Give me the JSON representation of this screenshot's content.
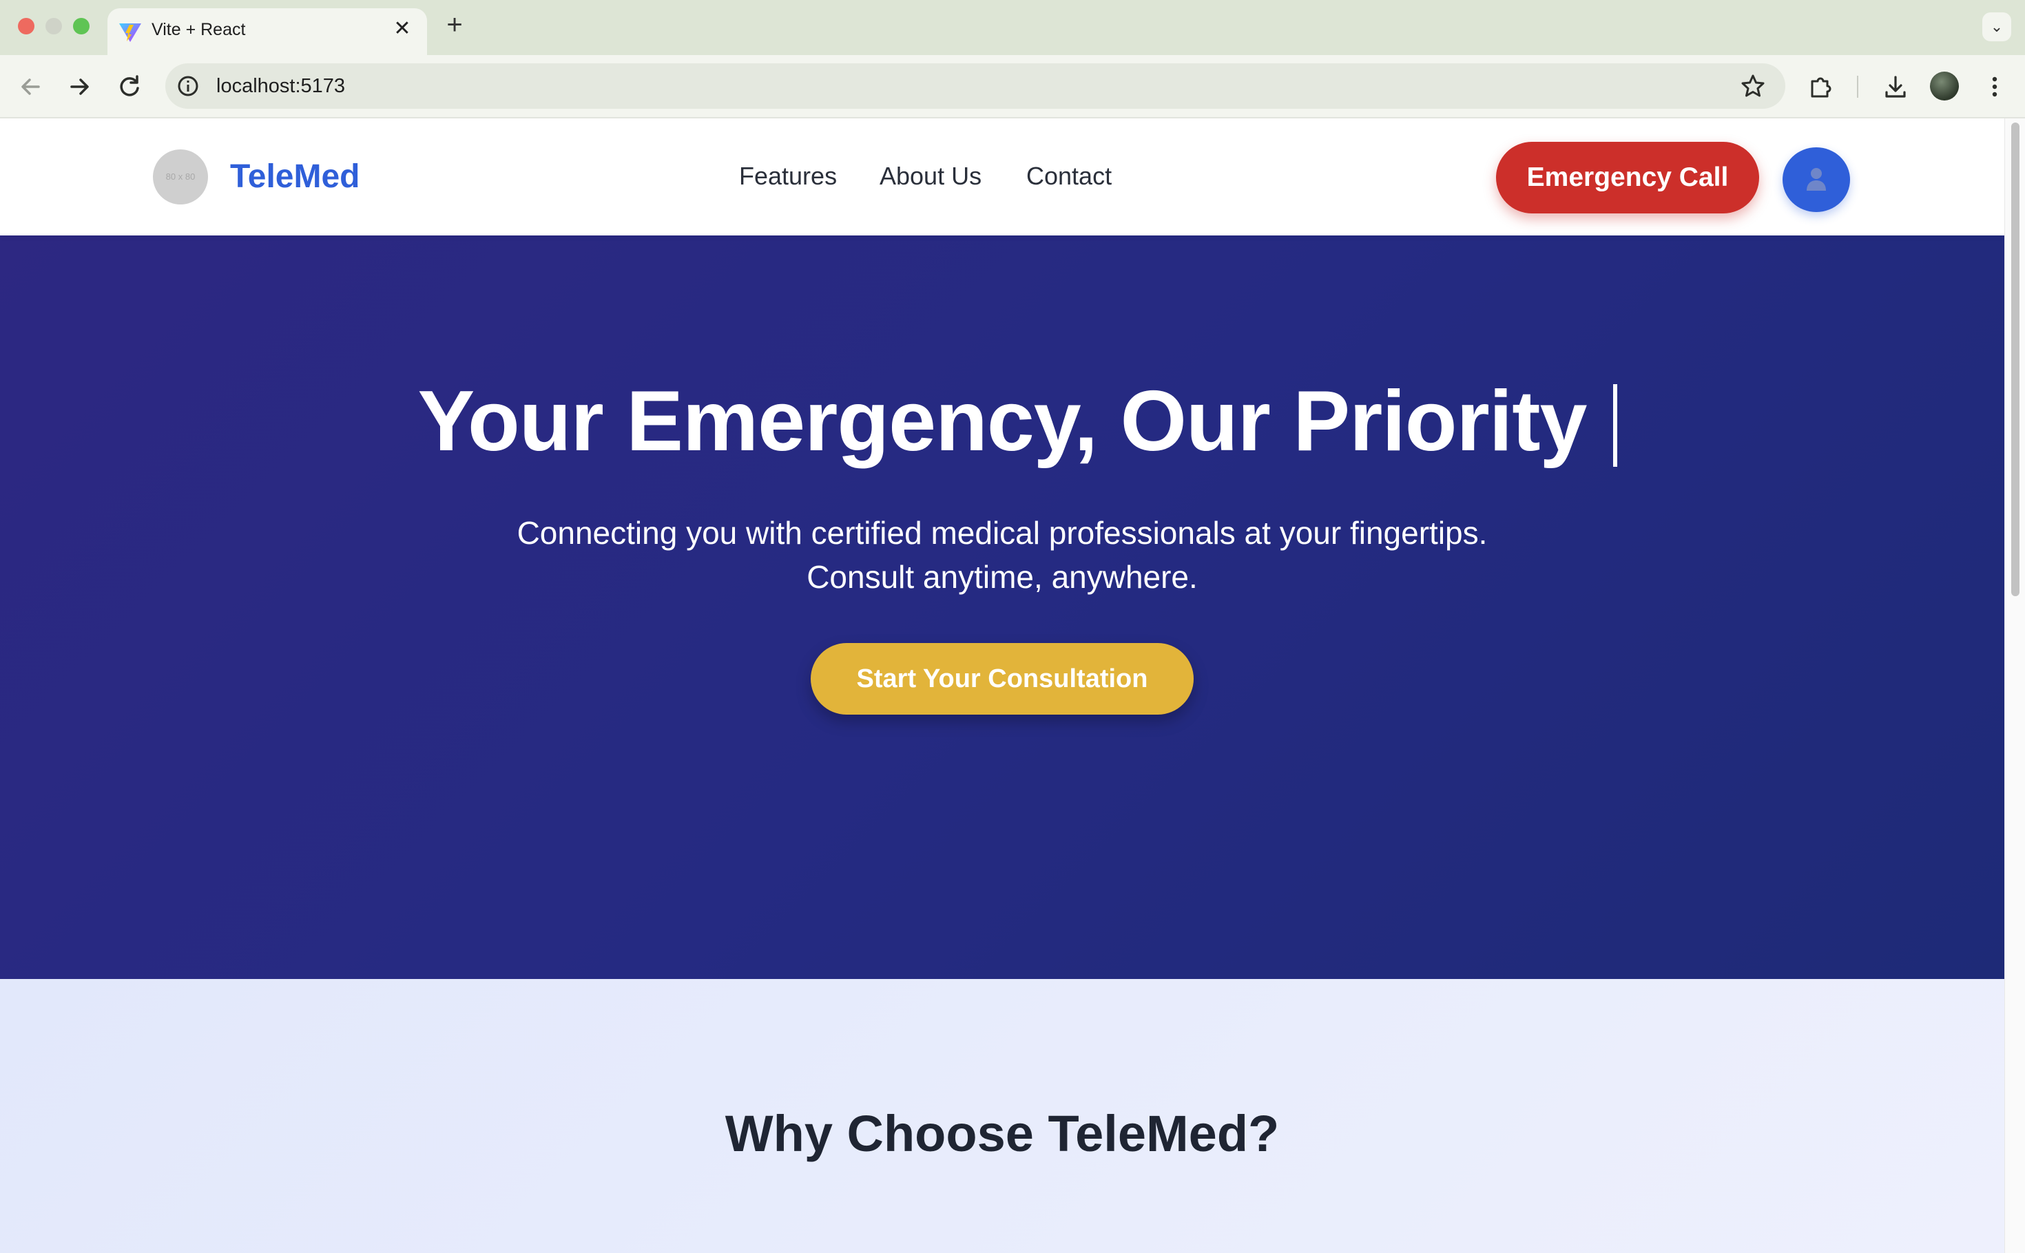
{
  "browser": {
    "tab_title": "Vite + React",
    "tab_close": "✕",
    "new_tab": "+",
    "address": "localhost:5173",
    "tab_search": "⌄"
  },
  "header": {
    "logo_placeholder": "80 x 80",
    "brand": "TeleMed",
    "nav": [
      "Features",
      "About Us",
      "Contact"
    ],
    "emergency_label": "Emergency Call"
  },
  "hero": {
    "title": "Your Emergency, Our Priority",
    "subtitle_line1": "Connecting you with certified medical professionals at your fingertips.",
    "subtitle_line2": "Consult anytime, anywhere.",
    "cta_label": "Start Your Consultation"
  },
  "features": {
    "title": "Why Choose TeleMed?"
  },
  "colors": {
    "brand_blue": "#2f5fd9",
    "emergency_red": "#cc2f2a",
    "hero_bg": "#25297f",
    "cta_gold": "#e2b43a",
    "features_bg": "#e6ebfb"
  },
  "icons": {
    "profile": "user-icon",
    "back": "arrow-left-icon",
    "forward": "arrow-right-icon",
    "reload": "reload-icon",
    "info": "info-icon",
    "bookmark": "star-icon",
    "extensions": "puzzle-icon",
    "download": "download-icon",
    "menu": "kebab-menu-icon"
  }
}
